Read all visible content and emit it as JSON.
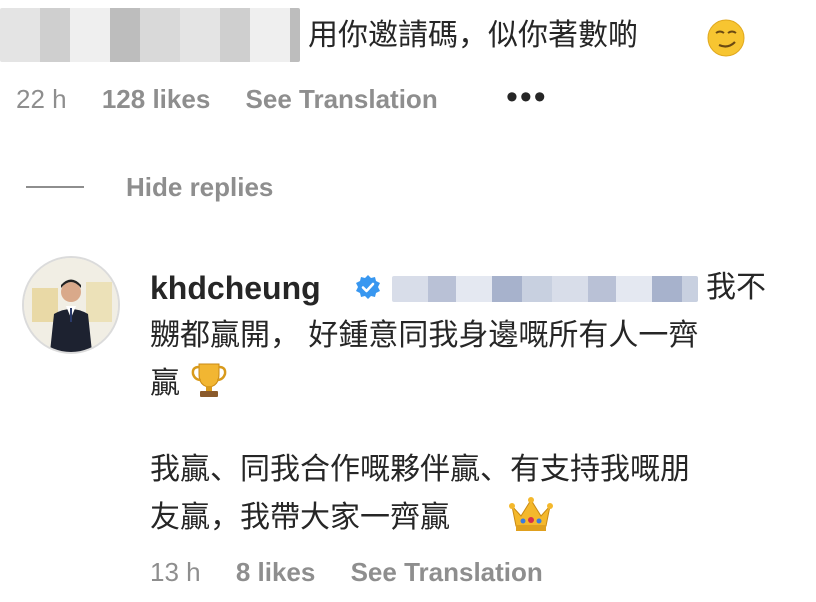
{
  "comment": {
    "text": "用你邀請碼，似你著數啲",
    "time": "22 h",
    "likes": "128 likes",
    "translate": "See Translation",
    "more": "•••",
    "emoji_icon": "smirking-face-emoji"
  },
  "replies_toggle": {
    "label": "Hide replies"
  },
  "reply": {
    "username": "khdcheung",
    "verified_icon": "verified-badge-icon",
    "line1_tail": "我不",
    "line2": "嬲都贏開， 好鍾意同我身邊嘅所有人一齊",
    "line3": "贏",
    "line4": "我贏、同我合作嘅夥伴贏、有支持我嘅朋",
    "line5": "友贏，我帶大家一齊贏",
    "trophy_icon": "trophy-emoji",
    "crown_icon": "crown-emoji",
    "time": "13 h",
    "likes": "8 likes",
    "translate": "See Translation"
  },
  "colors": {
    "text": "#262626",
    "muted": "#8e8e8e",
    "verified": "#3897f0"
  }
}
